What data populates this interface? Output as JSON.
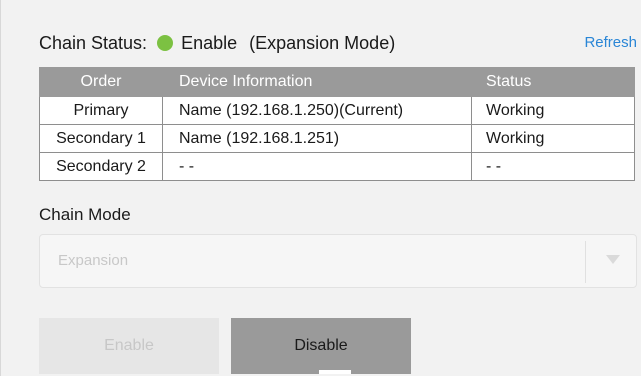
{
  "colors": {
    "status_ok": "#7cc142",
    "link": "#2a86d6"
  },
  "header": {
    "label": "Chain Status:",
    "status_text": "Enable",
    "mode_text": "(Expansion Mode)",
    "refresh_label": "Refresh"
  },
  "table": {
    "columns": [
      "Order",
      "Device Information",
      "Status"
    ],
    "rows": [
      {
        "order": "Primary",
        "device": "Name (192.168.1.250)(Current)",
        "status": "Working"
      },
      {
        "order": "Secondary 1",
        "device": "Name (192.168.1.251)",
        "status": "Working"
      },
      {
        "order": "Secondary 2",
        "device": "- -",
        "status": "- -"
      }
    ]
  },
  "chain_mode": {
    "label": "Chain Mode",
    "selected": "Expansion"
  },
  "buttons": {
    "enable_label": "Enable",
    "disable_label": "Disable"
  }
}
